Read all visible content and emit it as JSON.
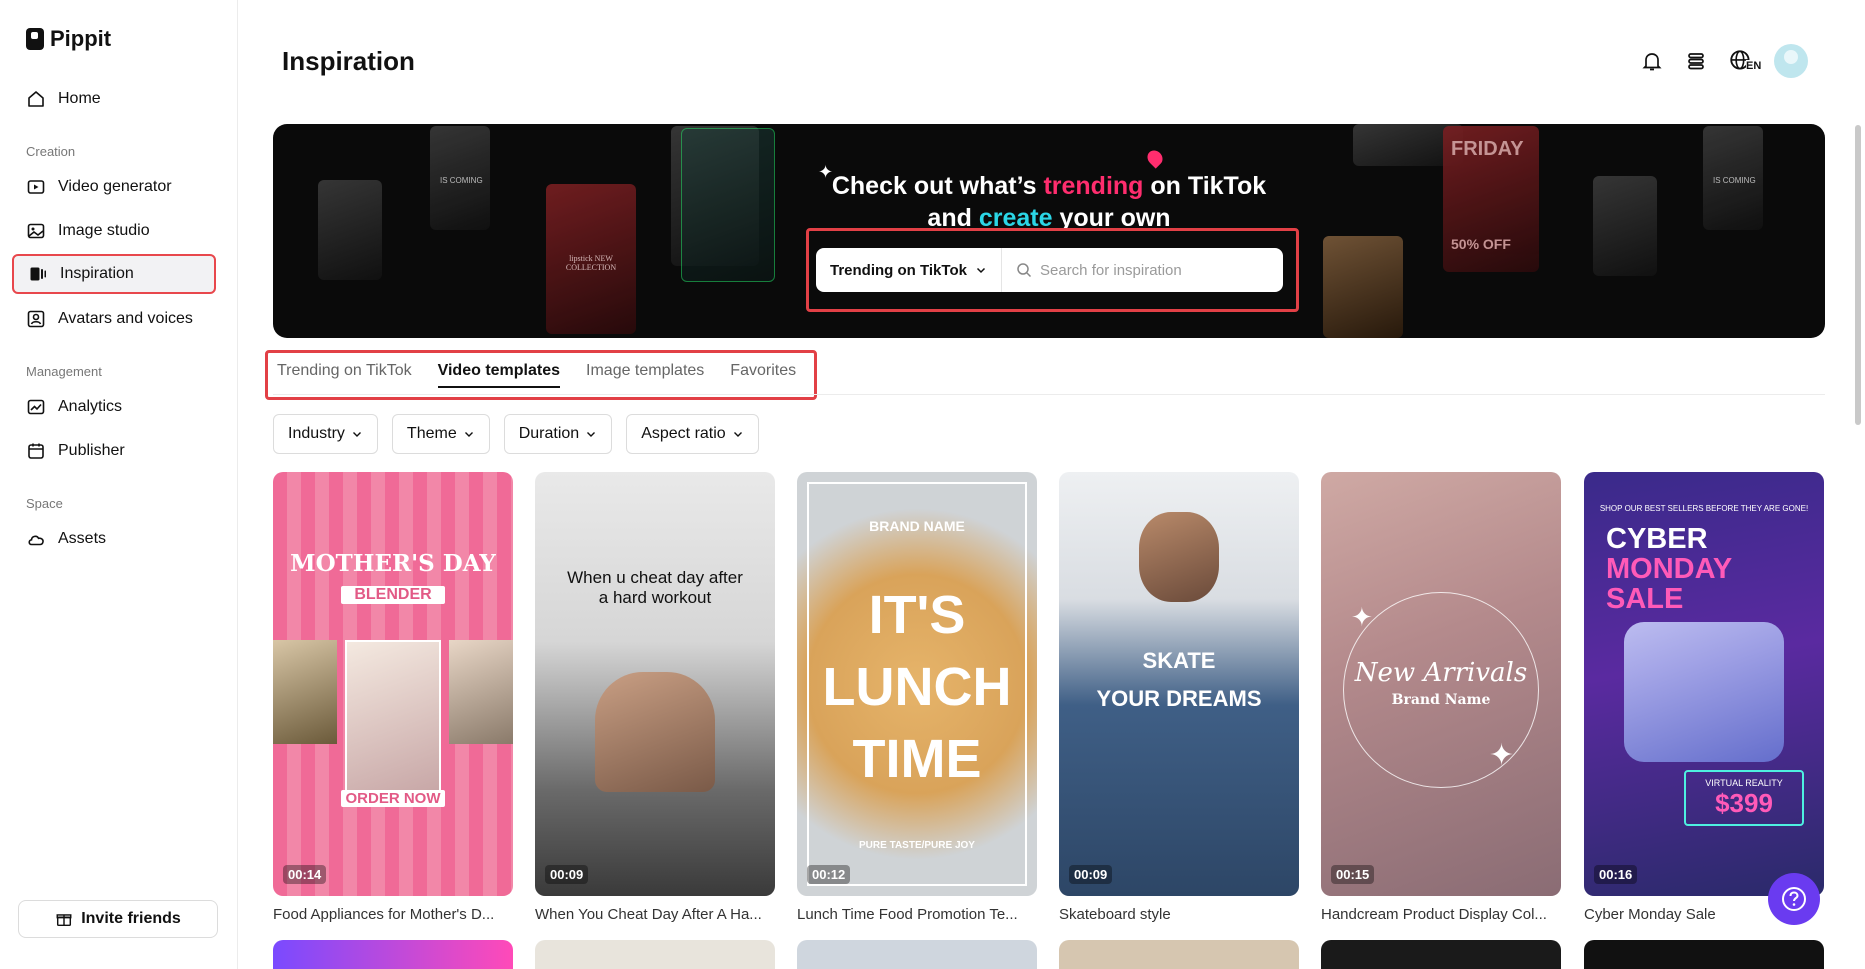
{
  "app": {
    "name": "Pippit"
  },
  "sidebar": {
    "home": "Home",
    "sections": {
      "creation": "Creation",
      "management": "Management",
      "space": "Space"
    },
    "creation_items": [
      "Video generator",
      "Image studio",
      "Inspiration",
      "Avatars and voices"
    ],
    "management_items": [
      "Analytics",
      "Publisher"
    ],
    "space_items": [
      "Assets"
    ],
    "invite": "Invite friends"
  },
  "header": {
    "title": "Inspiration",
    "language": "EN"
  },
  "banner": {
    "line1_pre": "Check out what’s ",
    "line1_hl": "trending",
    "line1_post": " on TikTok",
    "line2_pre": "and ",
    "line2_hl": "create",
    "line2_post": " your own",
    "search_select": "Trending on TikTok",
    "search_placeholder": "Search for inspiration"
  },
  "tabs": [
    "Trending on TikTok",
    "Video templates",
    "Image templates",
    "Favorites"
  ],
  "active_tab": "Video templates",
  "filters": [
    "Industry",
    "Theme",
    "Duration",
    "Aspect ratio"
  ],
  "cards": [
    {
      "title": "Food Appliances for Mother's D...",
      "duration": "00:14",
      "overlay": [
        "MOTHER'S DAY",
        "BLENDER",
        "ORDER NOW"
      ]
    },
    {
      "title": "When You Cheat Day After A Ha...",
      "duration": "00:09",
      "overlay": [
        "When u cheat day after",
        "a hard workout"
      ]
    },
    {
      "title": "Lunch Time Food Promotion Te...",
      "duration": "00:12",
      "overlay": [
        "BRAND NAME",
        "IT'S",
        "LUNCH",
        "TIME",
        "PURE TASTE/PURE JOY"
      ]
    },
    {
      "title": "Skateboard style",
      "duration": "00:09",
      "overlay": [
        "SKATE",
        "YOUR DREAMS"
      ]
    },
    {
      "title": "Handcream Product Display Col...",
      "duration": "00:15",
      "overlay": [
        "New Arrivals",
        "Brand Name"
      ]
    },
    {
      "title": "Cyber Monday Sale",
      "duration": "00:16",
      "overlay": [
        "SHOP OUR BEST SELLERS BEFORE THEY ARE GONE!",
        "CYBER",
        "MONDAY",
        "SALE",
        "VIRTUAL REALITY",
        "$399"
      ]
    }
  ],
  "banner_thumbs": [
    "IS COMING",
    "lipstick NEW COLLECTION",
    "FRIDAY",
    "50% OFF",
    "IS COMING"
  ]
}
